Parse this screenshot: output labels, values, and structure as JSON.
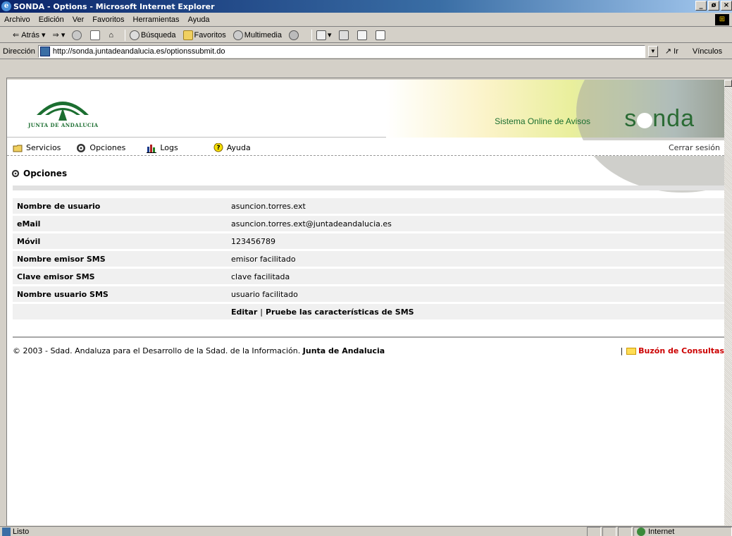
{
  "window": {
    "title": "SONDA - Options - Microsoft Internet Explorer",
    "min": "_",
    "max": "ø",
    "close": "×"
  },
  "menubar": [
    "Archivo",
    "Edición",
    "Ver",
    "Favoritos",
    "Herramientas",
    "Ayuda"
  ],
  "toolbar": {
    "back": "Atrás",
    "search": "Búsqueda",
    "favorites": "Favoritos",
    "multimedia": "Multimedia"
  },
  "address": {
    "label": "Dirección",
    "url": "http://sonda.juntadeandalucia.es/optionssubmit.do",
    "go": "Ir",
    "links": "Vínculos"
  },
  "banner": {
    "org": "JUNTA DE ANDALUCIA",
    "subtitle": "Sistema Online de Avisos",
    "brand_left": "s",
    "brand_right": "nda"
  },
  "nav": {
    "items": [
      "Servicios",
      "Opciones",
      "Logs",
      "Ayuda"
    ],
    "logout": "Cerrar sesión"
  },
  "section": {
    "title": "Opciones"
  },
  "options": [
    {
      "label": "Nombre de usuario",
      "value": "asuncion.torres.ext"
    },
    {
      "label": "eMail",
      "value": "asuncion.torres.ext@juntadeandalucia.es"
    },
    {
      "label": "Móvil",
      "value": "123456789"
    },
    {
      "label": "Nombre emisor SMS",
      "value": "emisor facilitado"
    },
    {
      "label": "Clave emisor SMS",
      "value": "clave facilitada"
    },
    {
      "label": "Nombre usuario SMS",
      "value": "usuario facilitado"
    }
  ],
  "actions": {
    "edit": "Editar",
    "separator": "|",
    "test_sms": "Pruebe las características de SMS"
  },
  "footer": {
    "copyright": "© 2003 - Sdad. Andaluza para el Desarrollo de la Sdad. de la Información.",
    "org": "Junta de Andalucia",
    "separator": "|",
    "contact": "Buzón de Consultas"
  },
  "statusbar": {
    "status": "Listo",
    "zone": "Internet"
  },
  "colors": {
    "brand_green": "#1b6e30",
    "link_red": "#cc0000",
    "row_bg": "#f0f0f0"
  }
}
